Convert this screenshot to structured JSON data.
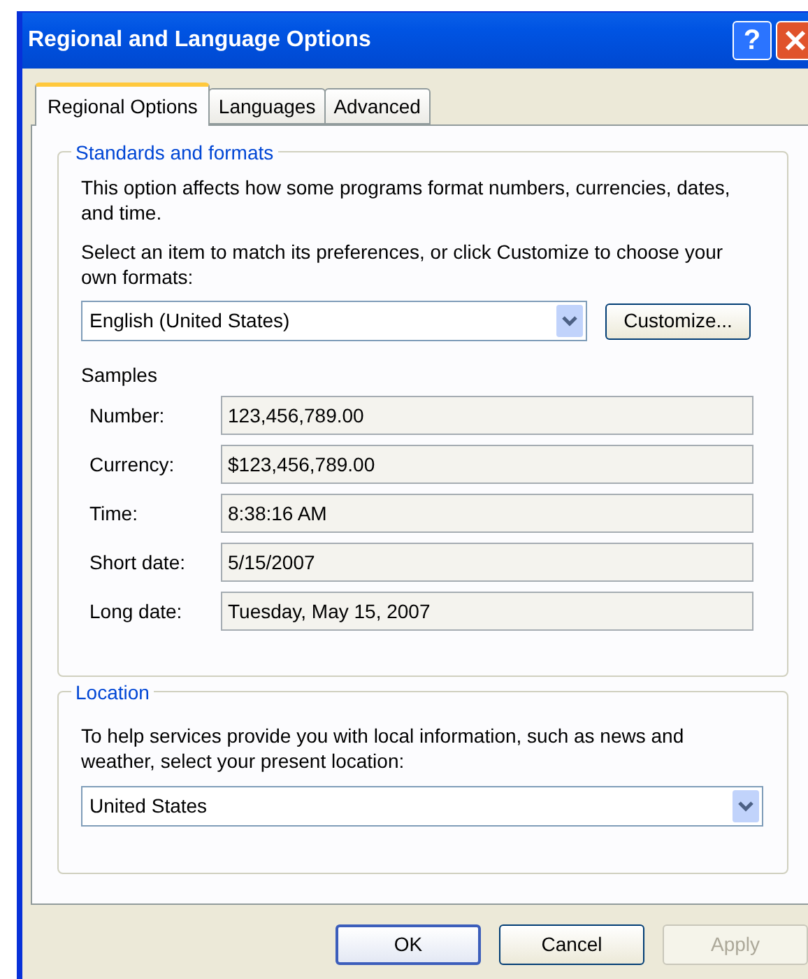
{
  "window": {
    "title": "Regional and Language Options",
    "title_buttons": [
      {
        "kind": "help",
        "label": "?"
      },
      {
        "kind": "close"
      }
    ]
  },
  "tabs": [
    {
      "label": "Regional Options",
      "selected": true
    },
    {
      "label": "Languages",
      "selected": false
    },
    {
      "label": "Advanced",
      "selected": false
    }
  ],
  "standards": {
    "title": "Standards and formats",
    "description": "This option affects how some programs format numbers, currencies, dates, and time.",
    "prompt": "Select an item to match its preferences, or click Customize to choose your own formats:",
    "format": "English (United States)",
    "customize_button": "Customize...",
    "samples_label": "Samples",
    "samples": [
      {
        "label": "Number:",
        "value": "123,456,789.00"
      },
      {
        "label": "Currency:",
        "value": "$123,456,789.00"
      },
      {
        "label": "Time:",
        "value": "8:38:16 AM"
      },
      {
        "label": "Short date:",
        "value": "5/15/2007"
      },
      {
        "label": "Long date:",
        "value": "Tuesday, May 15, 2007"
      }
    ]
  },
  "location": {
    "title": "Location",
    "description": "To help services provide you with local information, such as news and weather, select your present location:",
    "value": "United States"
  },
  "buttons": [
    {
      "label": "OK",
      "default": true,
      "disabled": false
    },
    {
      "label": "Cancel",
      "default": false,
      "disabled": false
    },
    {
      "label": "Apply",
      "default": false,
      "disabled": true
    }
  ]
}
